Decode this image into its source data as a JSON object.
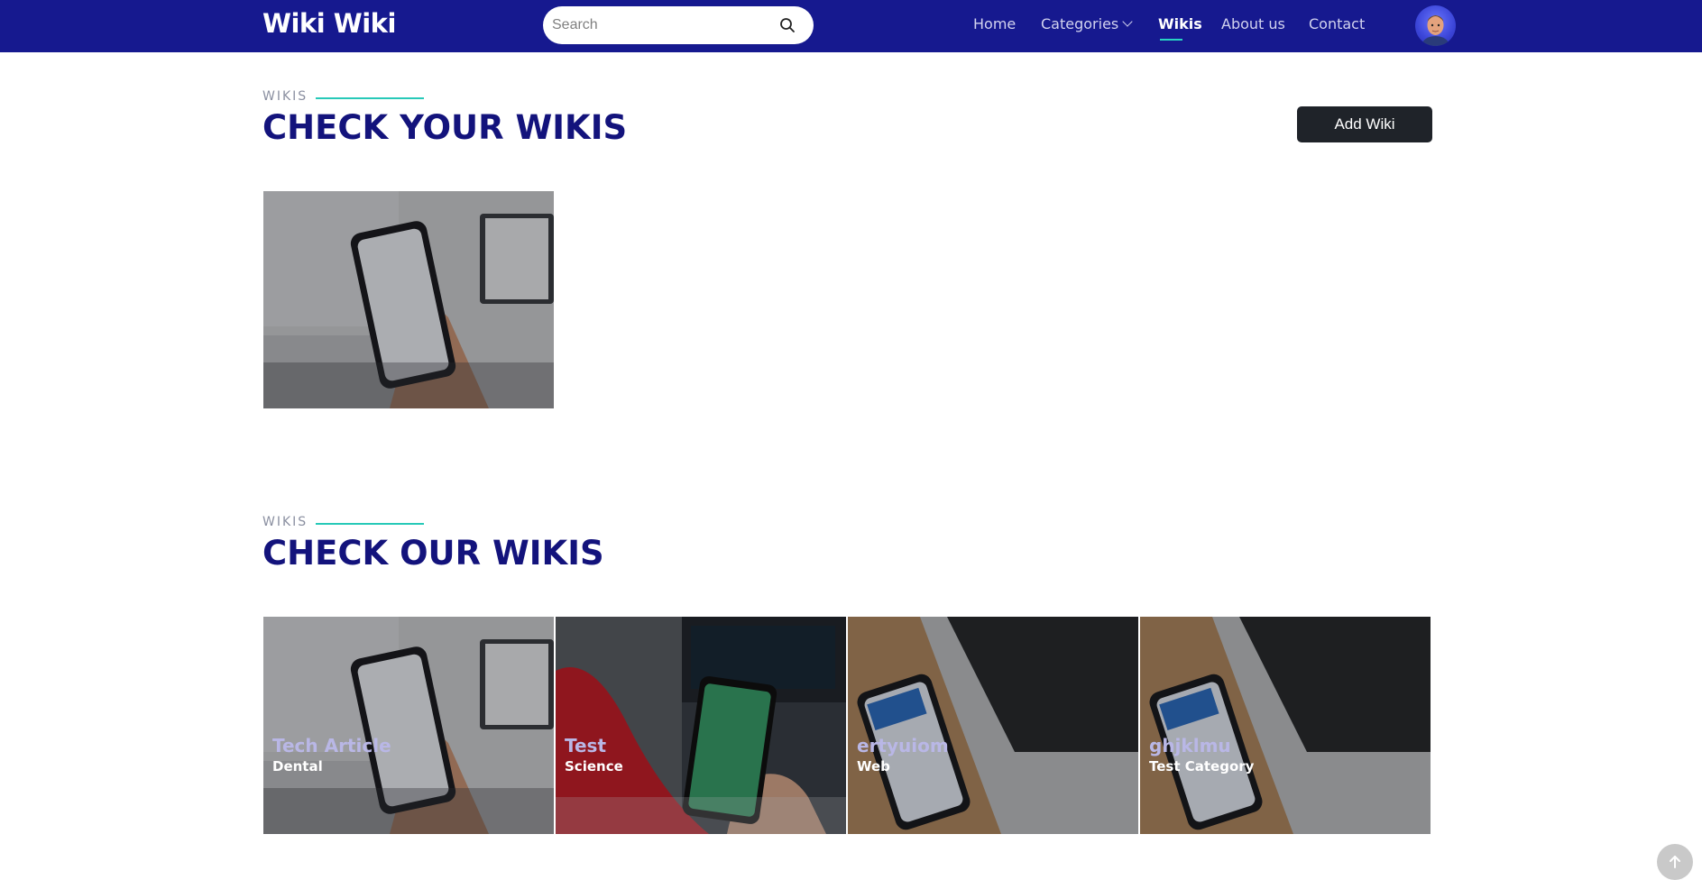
{
  "navbar": {
    "brand": "Wiki Wiki",
    "search_placeholder": "Search",
    "links": [
      {
        "label": "Home"
      },
      {
        "label": "Categories"
      },
      {
        "label": "Wikis"
      },
      {
        "label": "About us"
      },
      {
        "label": "Contact"
      }
    ],
    "active": "Wikis"
  },
  "your_wikis": {
    "eyebrow": "WIKIS",
    "heading": "CHECK YOUR WIKIS",
    "add_button": "Add Wiki"
  },
  "our_wikis": {
    "eyebrow": "WIKIS",
    "heading": "CHECK OUR WIKIS",
    "cards": [
      {
        "title": "Tech Article",
        "category": "Dental"
      },
      {
        "title": "Test",
        "category": "Science"
      },
      {
        "title": "ertyuiom",
        "category": "Web"
      },
      {
        "title": "ghjklmu",
        "category": "Test Category"
      }
    ]
  },
  "colors": {
    "navbar": "#16198f",
    "heading": "#13137c",
    "accent_line": "#27c9b8",
    "button": "#1f2329"
  }
}
